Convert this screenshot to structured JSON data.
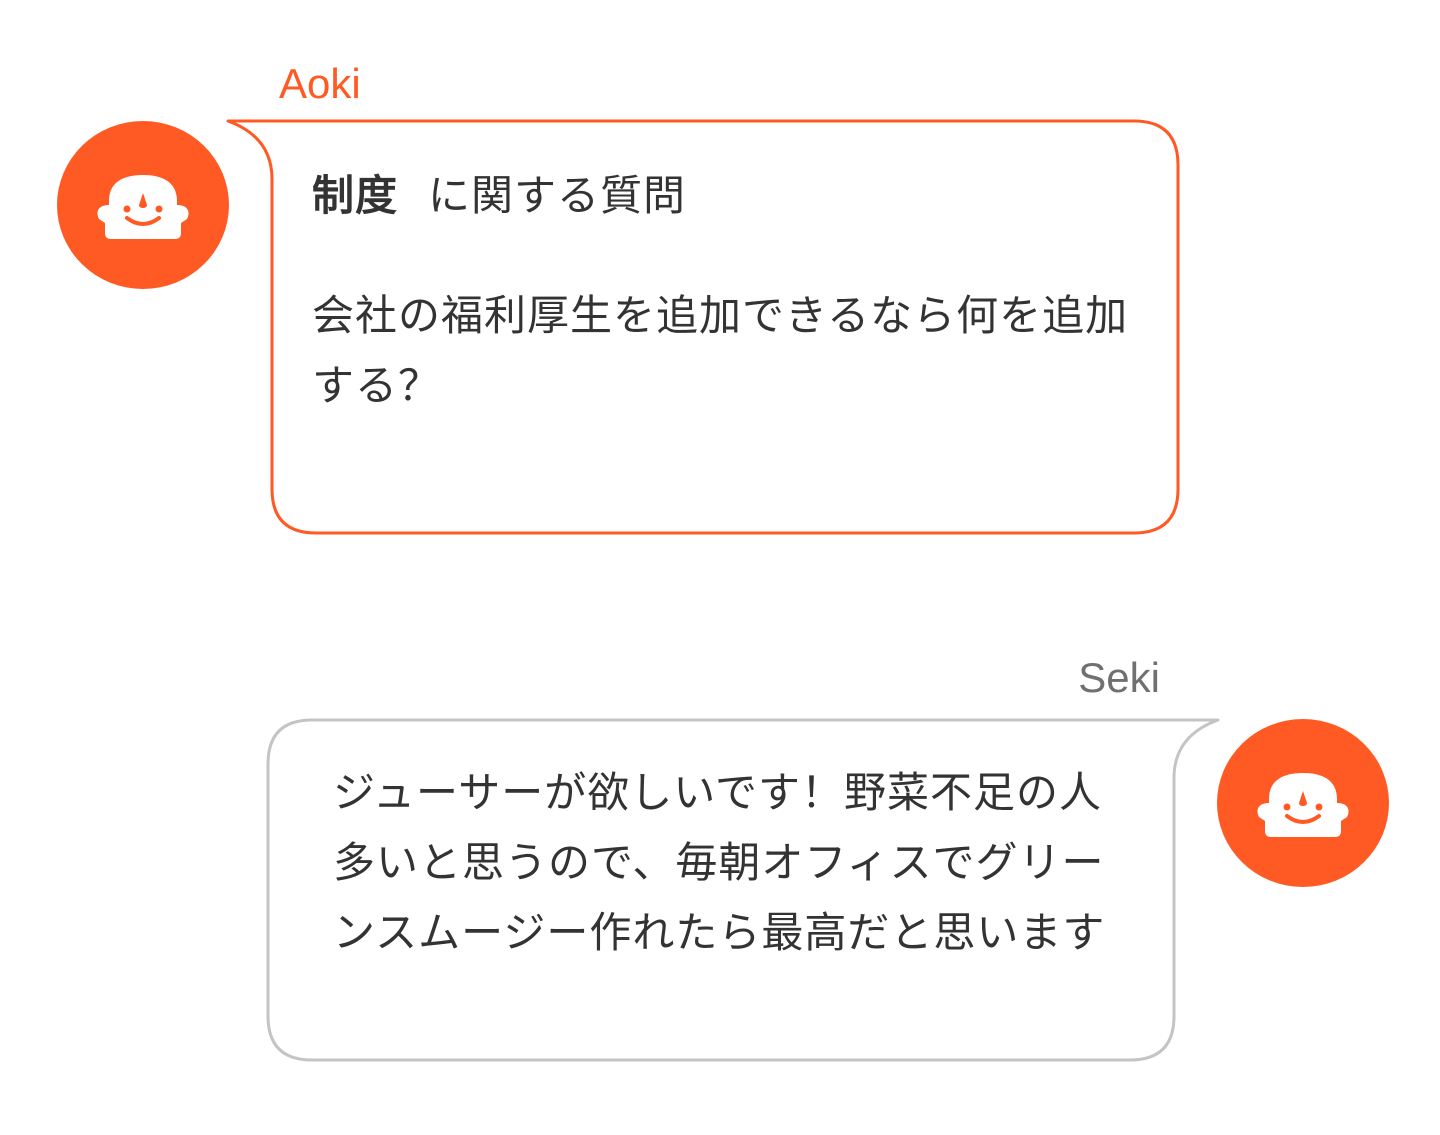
{
  "colors": {
    "accent": "#ff5a24",
    "text": "#333333",
    "secondary_name": "#707070",
    "reply_border": "#c4c4c4"
  },
  "messages": [
    {
      "sender": "Aoki",
      "avatar_icon": "smiley-face-icon",
      "topic_tag": "制度",
      "topic_suffix": "に関する質問",
      "text": "会社の福利厚生を追加できるなら何を追加する？"
    },
    {
      "sender": "Seki",
      "avatar_icon": "smiley-face-icon",
      "text": "ジューサーが欲しいです！野菜不足の人多いと思うので、毎朝オフィスでグリーンスムージー作れたら最高だと思います"
    }
  ]
}
